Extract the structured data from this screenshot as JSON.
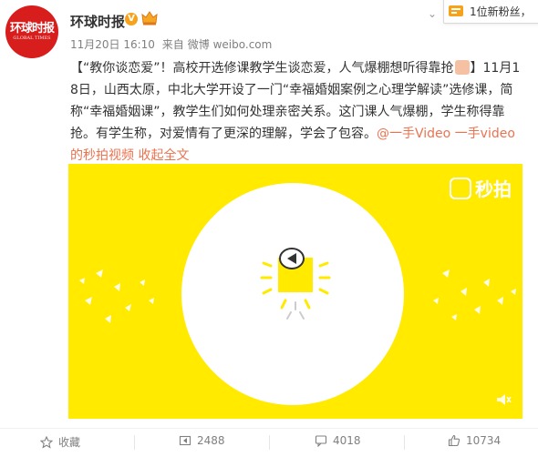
{
  "user": {
    "name": "环球时报",
    "avatar_text": "环球时报",
    "avatar_sub": "GLOBAL TIMES"
  },
  "meta": {
    "time": "11月20日 16:10",
    "source_prefix": "来自",
    "source": "微博 weibo.com"
  },
  "notification": {
    "text": "1位新粉丝，"
  },
  "post": {
    "part1": "【“教你谈恋爱”！高校开选修课教学生谈恋爱，人气爆棚想听得靠抢",
    "part2": "】11月18日，山西太原，中北大学开设了一门“幸福婚姻案例之心理学解读”选修课，简称“幸福婚姻课”，教学生们如何处理亲密关系。这门课人气爆棚，学生称得靠抢。有学生称，对爱情有了更深的理解，学会了包容。",
    "mention": "@一手Video",
    "video_link": "一手video的秒拍视频",
    "collapse": "收起全文"
  },
  "video": {
    "watermark": "秒拍",
    "bg_color": "#ffea00"
  },
  "actions": {
    "favorite": "收藏",
    "repost": "2488",
    "comment": "4018",
    "like": "10734"
  },
  "colors": {
    "link": "#eb7350",
    "brand_red": "#d81d1d"
  }
}
